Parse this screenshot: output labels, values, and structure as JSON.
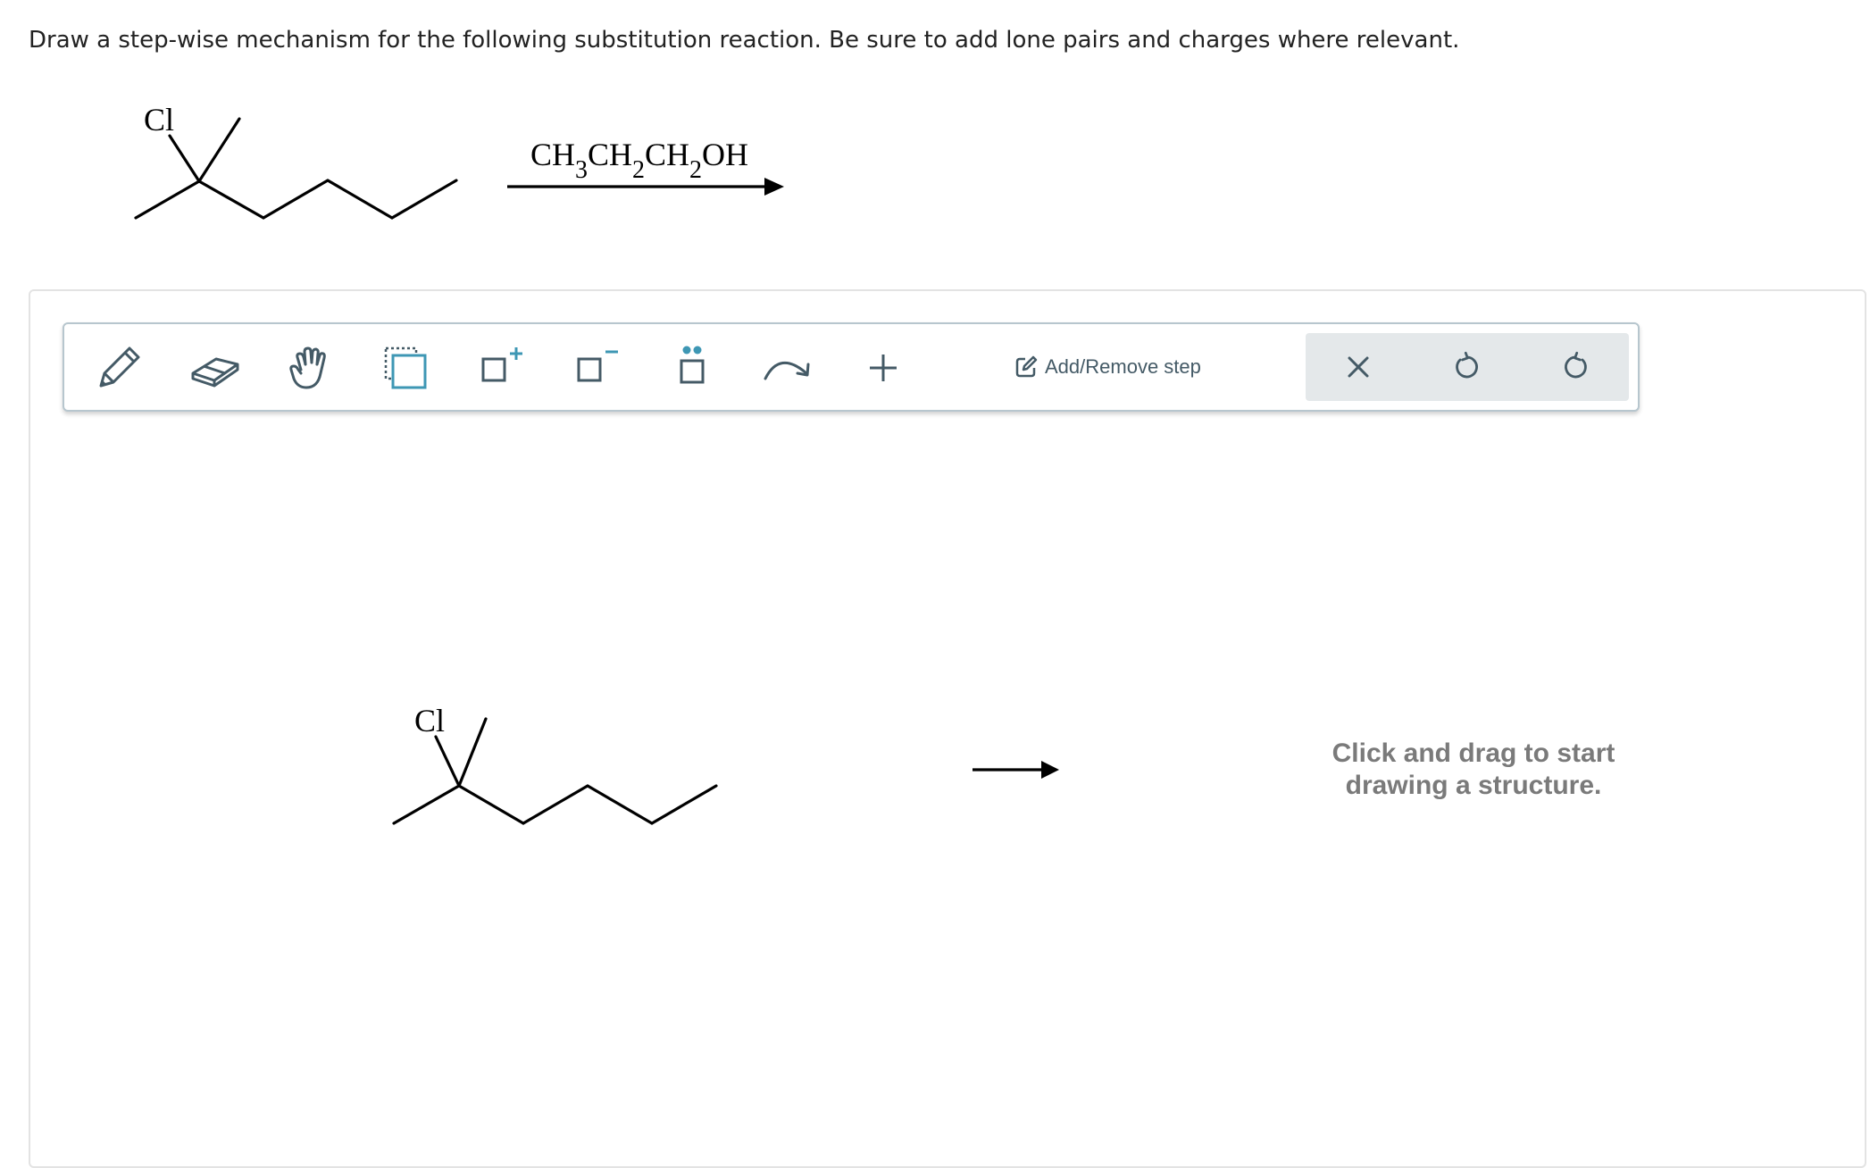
{
  "question": {
    "text": "Draw a step-wise mechanism for the following substitution reaction. Be sure to add lone pairs and charges where relevant."
  },
  "reaction": {
    "substituent_label": "Cl",
    "reagent": [
      {
        "text": "CH",
        "sub": "3"
      },
      {
        "text": "CH",
        "sub": "2"
      },
      {
        "text": "CH",
        "sub": "2"
      },
      {
        "text": "OH",
        "sub": ""
      }
    ]
  },
  "toolbar": {
    "tools": [
      {
        "name": "draw-pencil",
        "icon": "pencil-icon"
      },
      {
        "name": "eraser",
        "icon": "eraser-icon"
      },
      {
        "name": "hand-move",
        "icon": "hand-icon"
      },
      {
        "name": "select",
        "icon": "selection-box-icon"
      },
      {
        "name": "positive-charge",
        "icon": "plus-charge-icon"
      },
      {
        "name": "negative-charge",
        "icon": "minus-charge-icon"
      },
      {
        "name": "lone-pair",
        "icon": "lone-pair-icon"
      },
      {
        "name": "curved-arrow",
        "icon": "curved-arrow-icon"
      },
      {
        "name": "add-plus",
        "icon": "plus-icon"
      }
    ],
    "add_remove_step": "Add/Remove step",
    "history": [
      {
        "name": "clear",
        "icon": "close-icon"
      },
      {
        "name": "undo",
        "icon": "undo-icon"
      },
      {
        "name": "redo",
        "icon": "redo-icon"
      }
    ],
    "colors": {
      "icon": "#445a66",
      "accent": "#3e97b4",
      "history_bg": "#e4e8ea"
    }
  },
  "canvas": {
    "substituent_label": "Cl",
    "hint_line1": "Click and drag to start",
    "hint_line2": "drawing a structure."
  }
}
